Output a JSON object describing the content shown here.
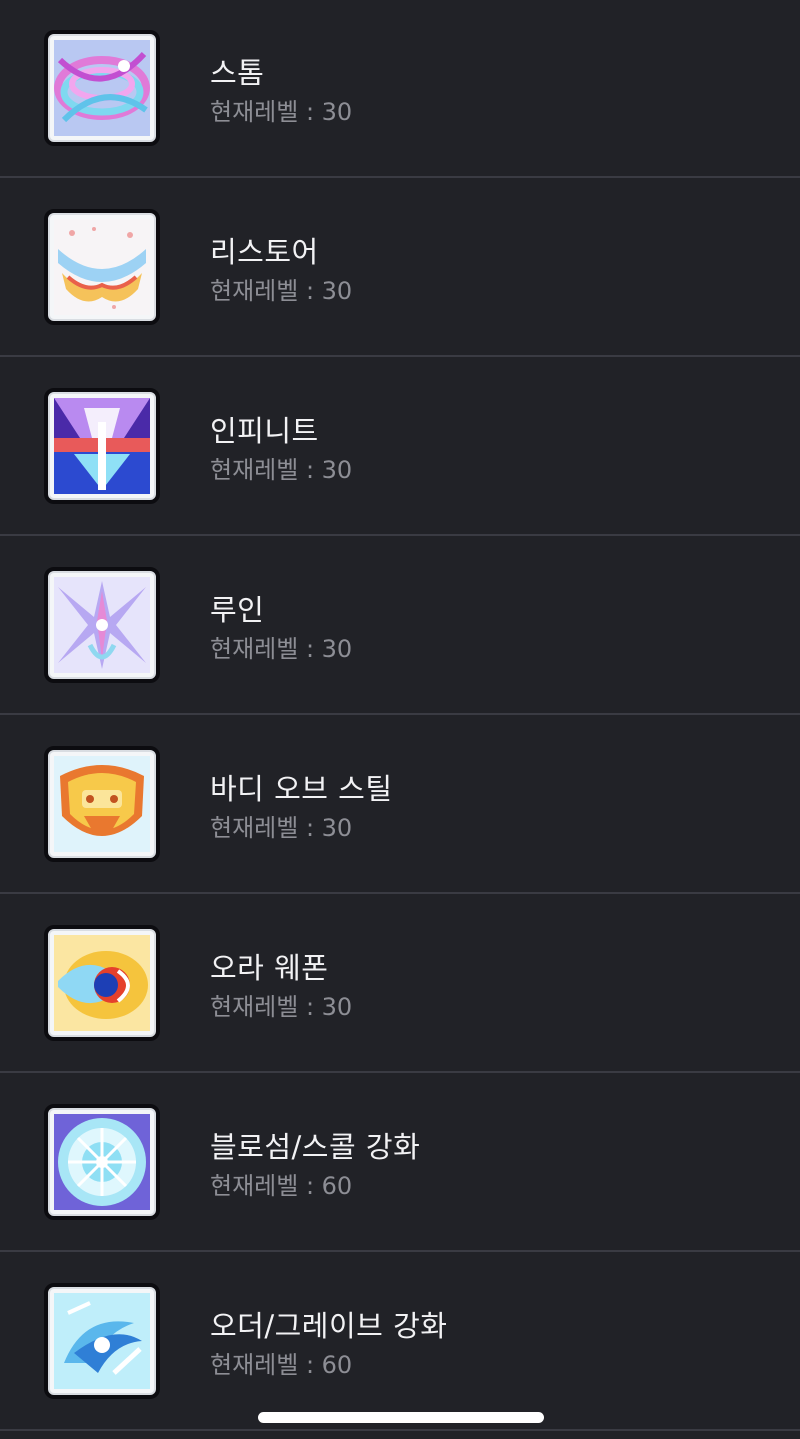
{
  "skills": [
    {
      "name": "스톰",
      "level_label": "현재레벨 : 30",
      "icon": "storm-icon"
    },
    {
      "name": "리스토어",
      "level_label": "현재레벨 : 30",
      "icon": "restore-icon"
    },
    {
      "name": "인피니트",
      "level_label": "현재레벨 : 30",
      "icon": "infinite-icon"
    },
    {
      "name": "루인",
      "level_label": "현재레벨 : 30",
      "icon": "ruin-icon"
    },
    {
      "name": "바디 오브 스틸",
      "level_label": "현재레벨 : 30",
      "icon": "body-of-steel-icon"
    },
    {
      "name": "오라 웨폰",
      "level_label": "현재레벨 : 30",
      "icon": "aura-weapon-icon"
    },
    {
      "name": "블로섬/스콜 강화",
      "level_label": "현재레벨 : 60",
      "icon": "blossom-squall-icon"
    },
    {
      "name": "오더/그레이브 강화",
      "level_label": "현재레벨 : 60",
      "icon": "order-grave-icon"
    }
  ],
  "colors": {
    "background": "#212227",
    "divider": "#3a3b43",
    "title_text": "#f2f2f4",
    "level_text": "#8d8e95"
  }
}
